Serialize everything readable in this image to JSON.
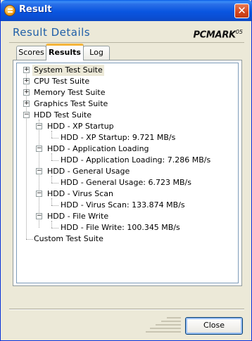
{
  "window": {
    "title": "Result"
  },
  "header": {
    "title": "Result Details",
    "logo": "PCMARK",
    "logo_suffix": "05"
  },
  "tabs": [
    {
      "label": "Scores",
      "active": false
    },
    {
      "label": "Results",
      "active": true
    },
    {
      "label": "Log",
      "active": false
    }
  ],
  "tree": {
    "suites": [
      {
        "label": "System Test Suite",
        "expander": "+"
      },
      {
        "label": "CPU Test Suite",
        "expander": "+"
      },
      {
        "label": "Memory Test Suite",
        "expander": "+"
      },
      {
        "label": "Graphics Test Suite",
        "expander": "+"
      },
      {
        "label": "HDD Test Suite",
        "expander": "−"
      }
    ],
    "hdd_tests": [
      {
        "label": "HDD - XP Startup",
        "result": "HDD - XP Startup: 9.721 MB/s"
      },
      {
        "label": "HDD - Application Loading",
        "result": "HDD - Application Loading: 7.286 MB/s"
      },
      {
        "label": "HDD - General Usage",
        "result": "HDD - General Usage: 6.723 MB/s"
      },
      {
        "label": "HDD - Virus Scan",
        "result": "HDD - Virus Scan: 133.874 MB/s"
      },
      {
        "label": "HDD - File Write",
        "result": "HDD - File Write: 100.345 MB/s"
      }
    ],
    "custom": "Custom Test Suite"
  },
  "footer": {
    "close_label": "Close"
  },
  "colors": {
    "titlebar": "#0a55e0",
    "header_text": "#1f5fa8",
    "active_tab_accent": "#f4b43a"
  }
}
